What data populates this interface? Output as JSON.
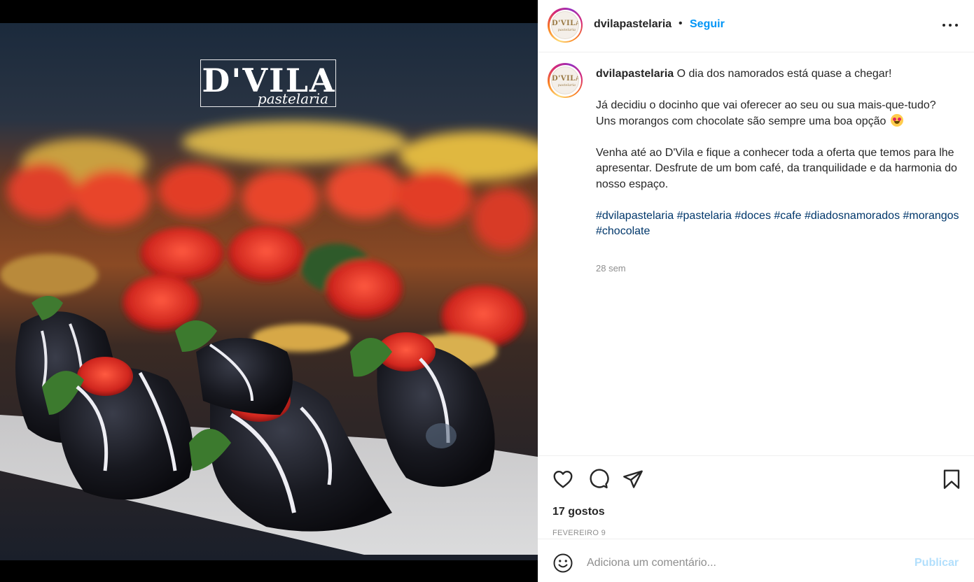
{
  "media": {
    "logo_word": "D'VILA",
    "logo_script": "pastelaria"
  },
  "header": {
    "username": "dvilapastelaria",
    "separator": "•",
    "follow_label": "Seguir",
    "more_icon": "more-horizontal-icon"
  },
  "avatar": {
    "logo_word": "D'VILA",
    "logo_script": "pastelaria"
  },
  "caption": {
    "username": "dvilapastelaria",
    "text": " O dia dos namorados está quase a chegar!\n\nJá decidiu o docinho que vai oferecer ao seu ou sua mais-que-tudo?\nUns morangos com chocolate são sempre uma boa opção ",
    "emoji": "smiling-face-with-heart-eyes-emoji",
    "text2": "\n\nVenha até ao D'Vila e fique a conhecer toda a oferta que temos para lhe apresentar. Desfrute de um bom café, da tranquilidade e da harmonia do nosso espaço.\n\n",
    "hashtags": "#dvilapastelaria #pastelaria #doces #cafe #diadosnamorados #morangos #chocolate",
    "time_ago": "28 sem"
  },
  "actions": {
    "like_icon": "heart-icon",
    "comment_icon": "comment-icon",
    "share_icon": "paper-plane-icon",
    "save_icon": "bookmark-icon",
    "likes_text": "17 gostos",
    "date_text": "FEVEREIRO 9"
  },
  "comment_bar": {
    "emoji_icon": "smiley-icon",
    "placeholder": "Adiciona um comentário...",
    "publish_label": "Publicar"
  },
  "colors": {
    "follow_blue": "#0095f6",
    "hashtag_blue": "#00376b",
    "publish_disabled": "#b2dffc",
    "text_muted": "#8e8e8e"
  }
}
